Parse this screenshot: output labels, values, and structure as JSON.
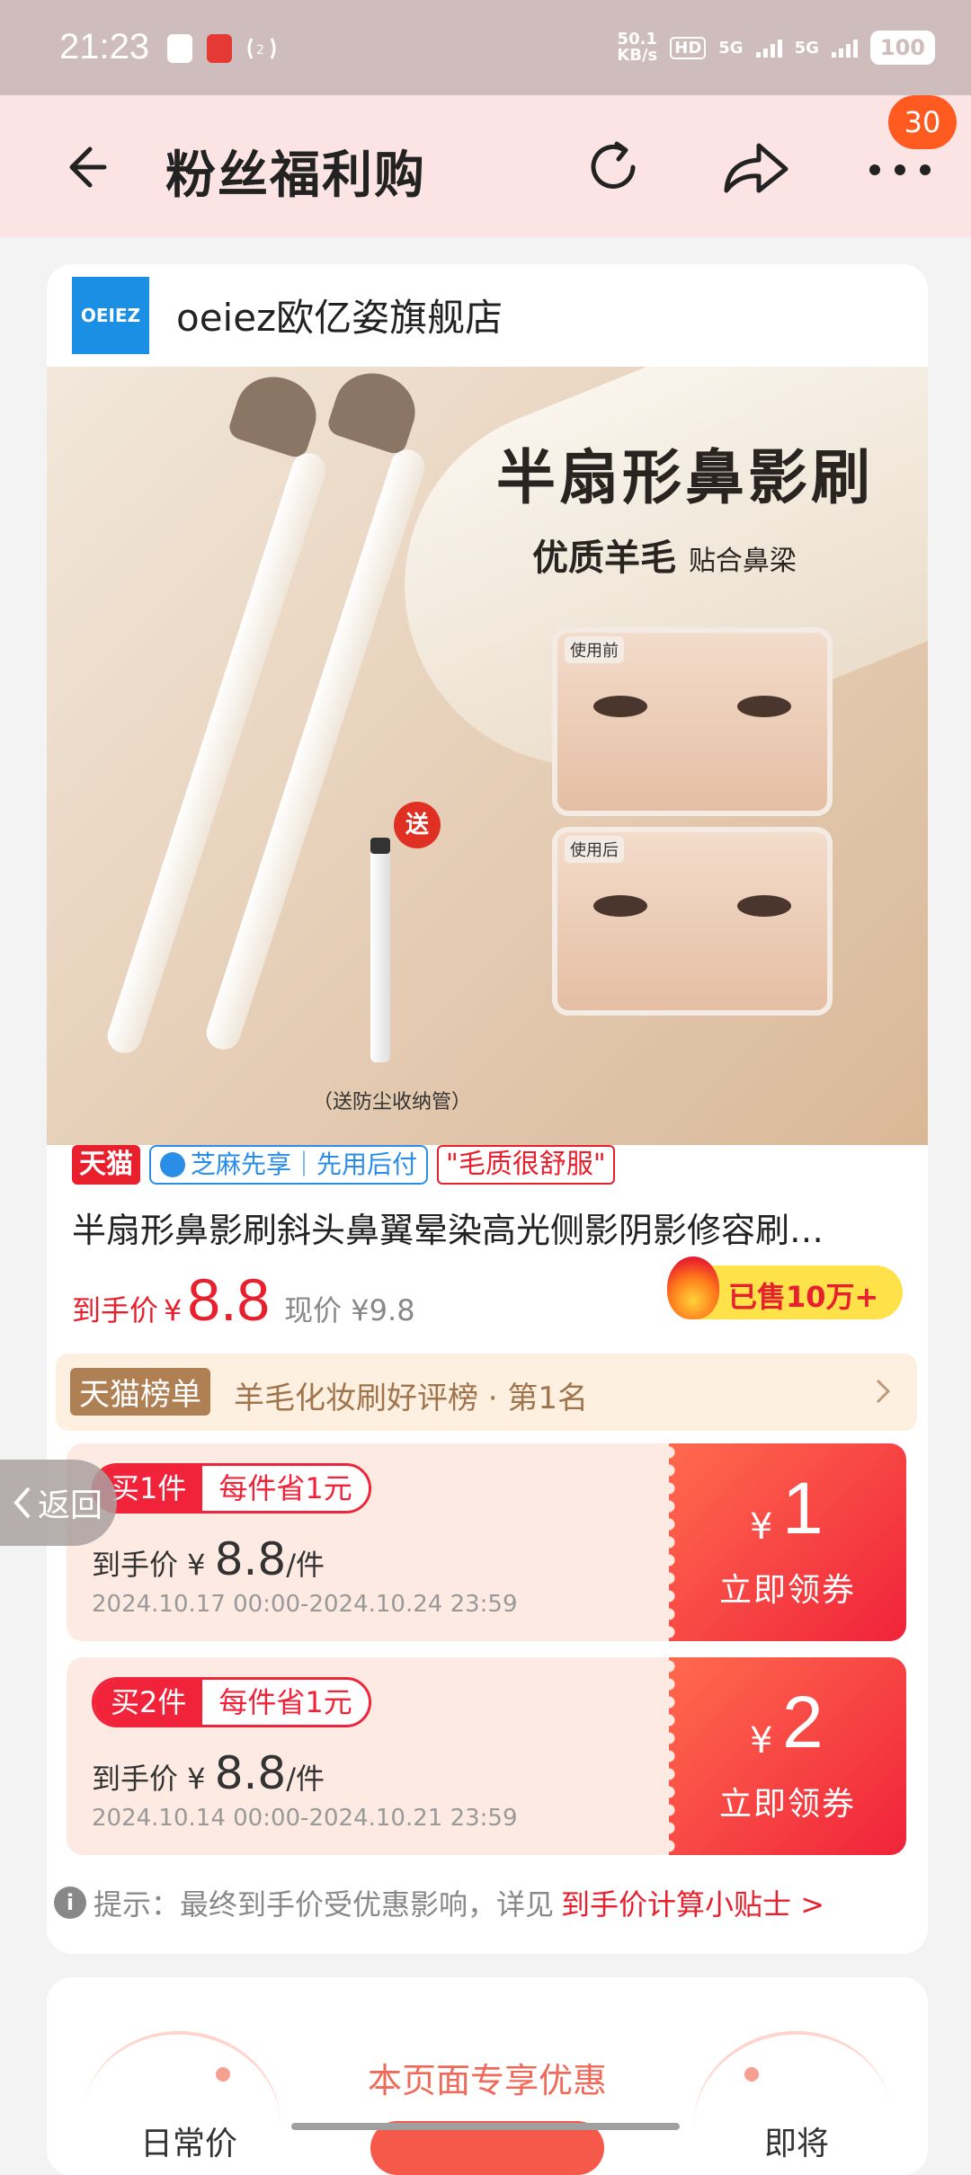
{
  "status_bar": {
    "time": "21:23",
    "net_speed_value": "50.1",
    "net_speed_unit": "KB/s",
    "hd": "HD",
    "net1": "5G",
    "net2": "5G",
    "battery": "100"
  },
  "nav": {
    "title": "粉丝福利购",
    "badge": "30"
  },
  "store": {
    "logo_text": "OEIEZ",
    "name": "oeiez欧亿姿旗舰店"
  },
  "product_image": {
    "headline": "半扇形鼻影刷",
    "sub_bold": "优质羊毛",
    "sub_normal": "贴合鼻梁",
    "before_label": "使用前",
    "after_label": "使用后",
    "gift_badge": "送",
    "gift_caption": "（送防尘收纳管）"
  },
  "tags": {
    "tmall": "天猫",
    "zhima": "芝麻先享｜先用后付",
    "quote": "\"毛质很舒服\""
  },
  "product": {
    "title": "半扇形鼻影刷斜头鼻翼晕染高光侧影阴影修容刷…",
    "price_label": "到手价",
    "price_symbol": "¥",
    "price_value": "8.8",
    "current_price": "现价 ¥9.8",
    "sold": "已售10万+"
  },
  "rank": {
    "tag": "天猫榜单",
    "text": "羊毛化妆刷好评榜 · 第1名"
  },
  "coupons": [
    {
      "buy": "买1件",
      "save": "每件省1元",
      "price_label": "到手价 ¥ ",
      "price_value": "8.8",
      "unit": "/件",
      "date": "2024.10.17 00:00-2024.10.24 23:59",
      "symbol": "¥",
      "amount": "1",
      "claim": "立即领券"
    },
    {
      "buy": "买2件",
      "save": "每件省1元",
      "price_label": "到手价 ¥ ",
      "price_value": "8.8",
      "unit": "/件",
      "date": "2024.10.14 00:00-2024.10.21 23:59",
      "symbol": "¥",
      "amount": "2",
      "claim": "立即领券"
    }
  ],
  "tip": {
    "icon": "i",
    "text": "提示：最终到手价受优惠影响，详见",
    "link": "到手价计算小贴士 >"
  },
  "side_back": "返回",
  "section2": {
    "title": "本页面专享优惠",
    "left_label": "日常价",
    "right_label": "即将"
  }
}
